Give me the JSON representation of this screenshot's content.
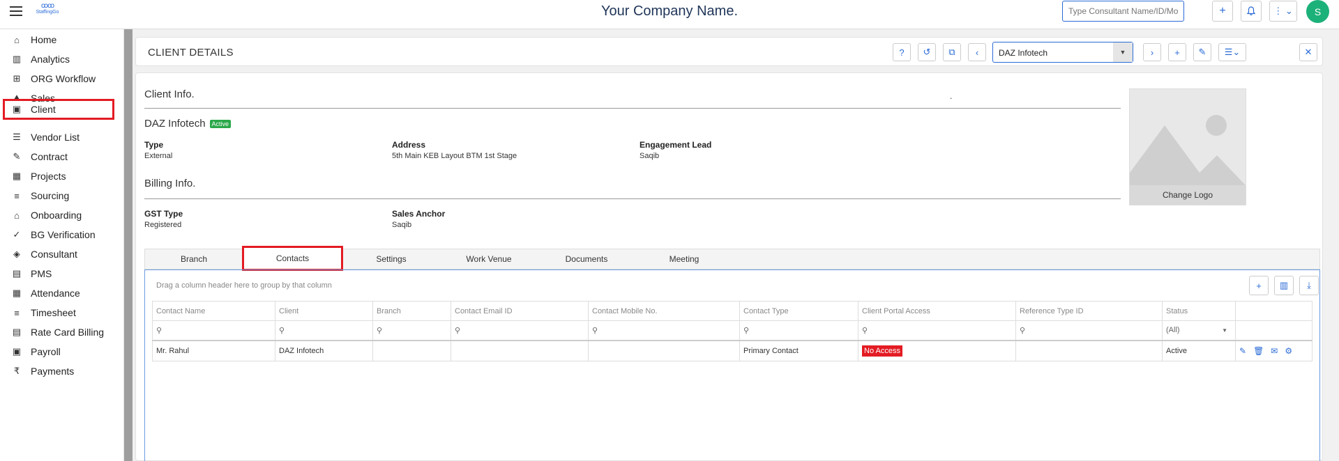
{
  "header": {
    "company_name": "Your Company Name.",
    "logo_text": "StaffingGo",
    "search_placeholder": "Type Consultant Name/ID/Mobile/...",
    "avatar_letter": "S"
  },
  "sidebar": {
    "items": [
      {
        "label": "Home",
        "icon": "home-icon",
        "glyph": "⌂"
      },
      {
        "label": "Analytics",
        "icon": "analytics-icon",
        "glyph": "▥"
      },
      {
        "label": "ORG Workflow",
        "icon": "workflow-icon",
        "glyph": "⊞"
      },
      {
        "label": "Sales",
        "icon": "sales-icon",
        "glyph": "⛰"
      },
      {
        "label": "Client",
        "icon": "client-icon",
        "glyph": "▣"
      },
      {
        "label": "Vendor List",
        "icon": "vendor-list-icon",
        "glyph": "☰"
      },
      {
        "label": "Contract",
        "icon": "contract-icon",
        "glyph": "✎"
      },
      {
        "label": "Projects",
        "icon": "projects-icon",
        "glyph": "▦"
      },
      {
        "label": "Sourcing",
        "icon": "sourcing-icon",
        "glyph": "≡"
      },
      {
        "label": "Onboarding",
        "icon": "onboarding-icon",
        "glyph": "⌂"
      },
      {
        "label": "BG Verification",
        "icon": "bg-verification-icon",
        "glyph": "✓"
      },
      {
        "label": "Consultant",
        "icon": "consultant-icon",
        "glyph": "◈"
      },
      {
        "label": "PMS",
        "icon": "pms-icon",
        "glyph": "▤"
      },
      {
        "label": "Attendance",
        "icon": "attendance-icon",
        "glyph": "▦"
      },
      {
        "label": "Timesheet",
        "icon": "timesheet-icon",
        "glyph": "≡"
      },
      {
        "label": "Rate Card Billing",
        "icon": "rate-card-icon",
        "glyph": "▤"
      },
      {
        "label": "Payroll",
        "icon": "payroll-icon",
        "glyph": "▣"
      },
      {
        "label": "Payments",
        "icon": "payments-icon",
        "glyph": "₹"
      }
    ]
  },
  "page": {
    "title": "CLIENT DETAILS",
    "selected_client": "DAZ Infotech"
  },
  "client_info": {
    "section_title": "Client Info.",
    "dot": ".",
    "name": "DAZ Infotech",
    "status": "Active",
    "fields": [
      {
        "label": "Type",
        "value": "External"
      },
      {
        "label": "Address",
        "value": "5th Main KEB Layout BTM 1st Stage"
      },
      {
        "label": "Engagement Lead",
        "value": "Saqib"
      }
    ]
  },
  "billing_info": {
    "section_title": "Billing Info.",
    "fields": [
      {
        "label": "GST Type",
        "value": "Registered"
      },
      {
        "label": "Sales Anchor",
        "value": "Saqib"
      }
    ]
  },
  "logo_box": {
    "change_label": "Change Logo"
  },
  "tabs": [
    {
      "label": "Branch"
    },
    {
      "label": "Contacts"
    },
    {
      "label": "Settings"
    },
    {
      "label": "Work Venue"
    },
    {
      "label": "Documents"
    },
    {
      "label": "Meeting"
    }
  ],
  "grid": {
    "group_hint": "Drag a column header here to group by that column",
    "columns": [
      "Contact Name",
      "Client",
      "Branch",
      "Contact Email ID",
      "Contact Mobile No.",
      "Contact Type",
      "Client Portal Access",
      "Reference Type ID",
      "Status",
      ""
    ],
    "status_filter": "(All)",
    "rows": [
      {
        "contact_name": "Mr. Rahul",
        "client": "DAZ Infotech",
        "branch": "",
        "email": "",
        "mobile": "",
        "contact_type": "Primary Contact",
        "portal_access": "No Access",
        "reference_type_id": "",
        "status": "Active"
      }
    ]
  },
  "colors": {
    "accent": "#2a6bd6",
    "highlight": "#e31b23",
    "active_badge": "#2aa84a",
    "avatar": "#1db17a"
  }
}
